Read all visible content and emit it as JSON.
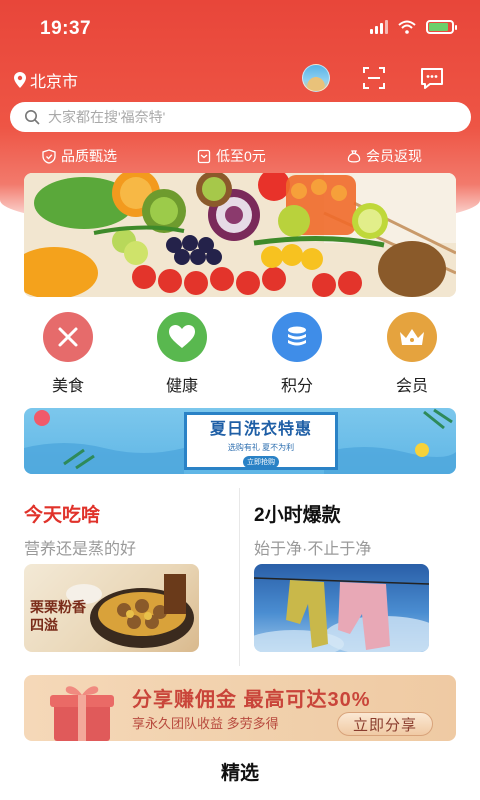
{
  "status_bar": {
    "time": "19:37"
  },
  "header": {
    "location": "北京市",
    "search_placeholder": "大家都在搜'福奈特'",
    "badges": [
      "品质甄选",
      "低至0元",
      "会员返现"
    ]
  },
  "categories": [
    {
      "label": "美食",
      "color": "#e66b6b",
      "icon": "fork-knife-icon"
    },
    {
      "label": "健康",
      "color": "#59b84f",
      "icon": "heart-icon"
    },
    {
      "label": "积分",
      "color": "#3f8de8",
      "icon": "coins-icon"
    },
    {
      "label": "会员",
      "color": "#e5a33e",
      "icon": "crown-icon"
    }
  ],
  "promo_banner": {
    "title": "夏日洗衣特惠",
    "subtitle": "选购有礼 夏不为利",
    "tag": "立即抢购"
  },
  "sections": {
    "left": {
      "title": "今天吃啥",
      "subtitle": "营养还是蒸的好",
      "image_text": "栗栗粉香四溢"
    },
    "right": {
      "title": "2小时爆款",
      "subtitle": "始于净·不止于净"
    }
  },
  "share_banner": {
    "title": "分享赚佣金  最高可达30%",
    "subtitle": "享永久团队收益  多劳多得",
    "button": "立即分享"
  },
  "bottom_tab": {
    "label": "精选"
  },
  "colors": {
    "header_red": "#e8463a",
    "left_title_red": "#e0322a"
  }
}
